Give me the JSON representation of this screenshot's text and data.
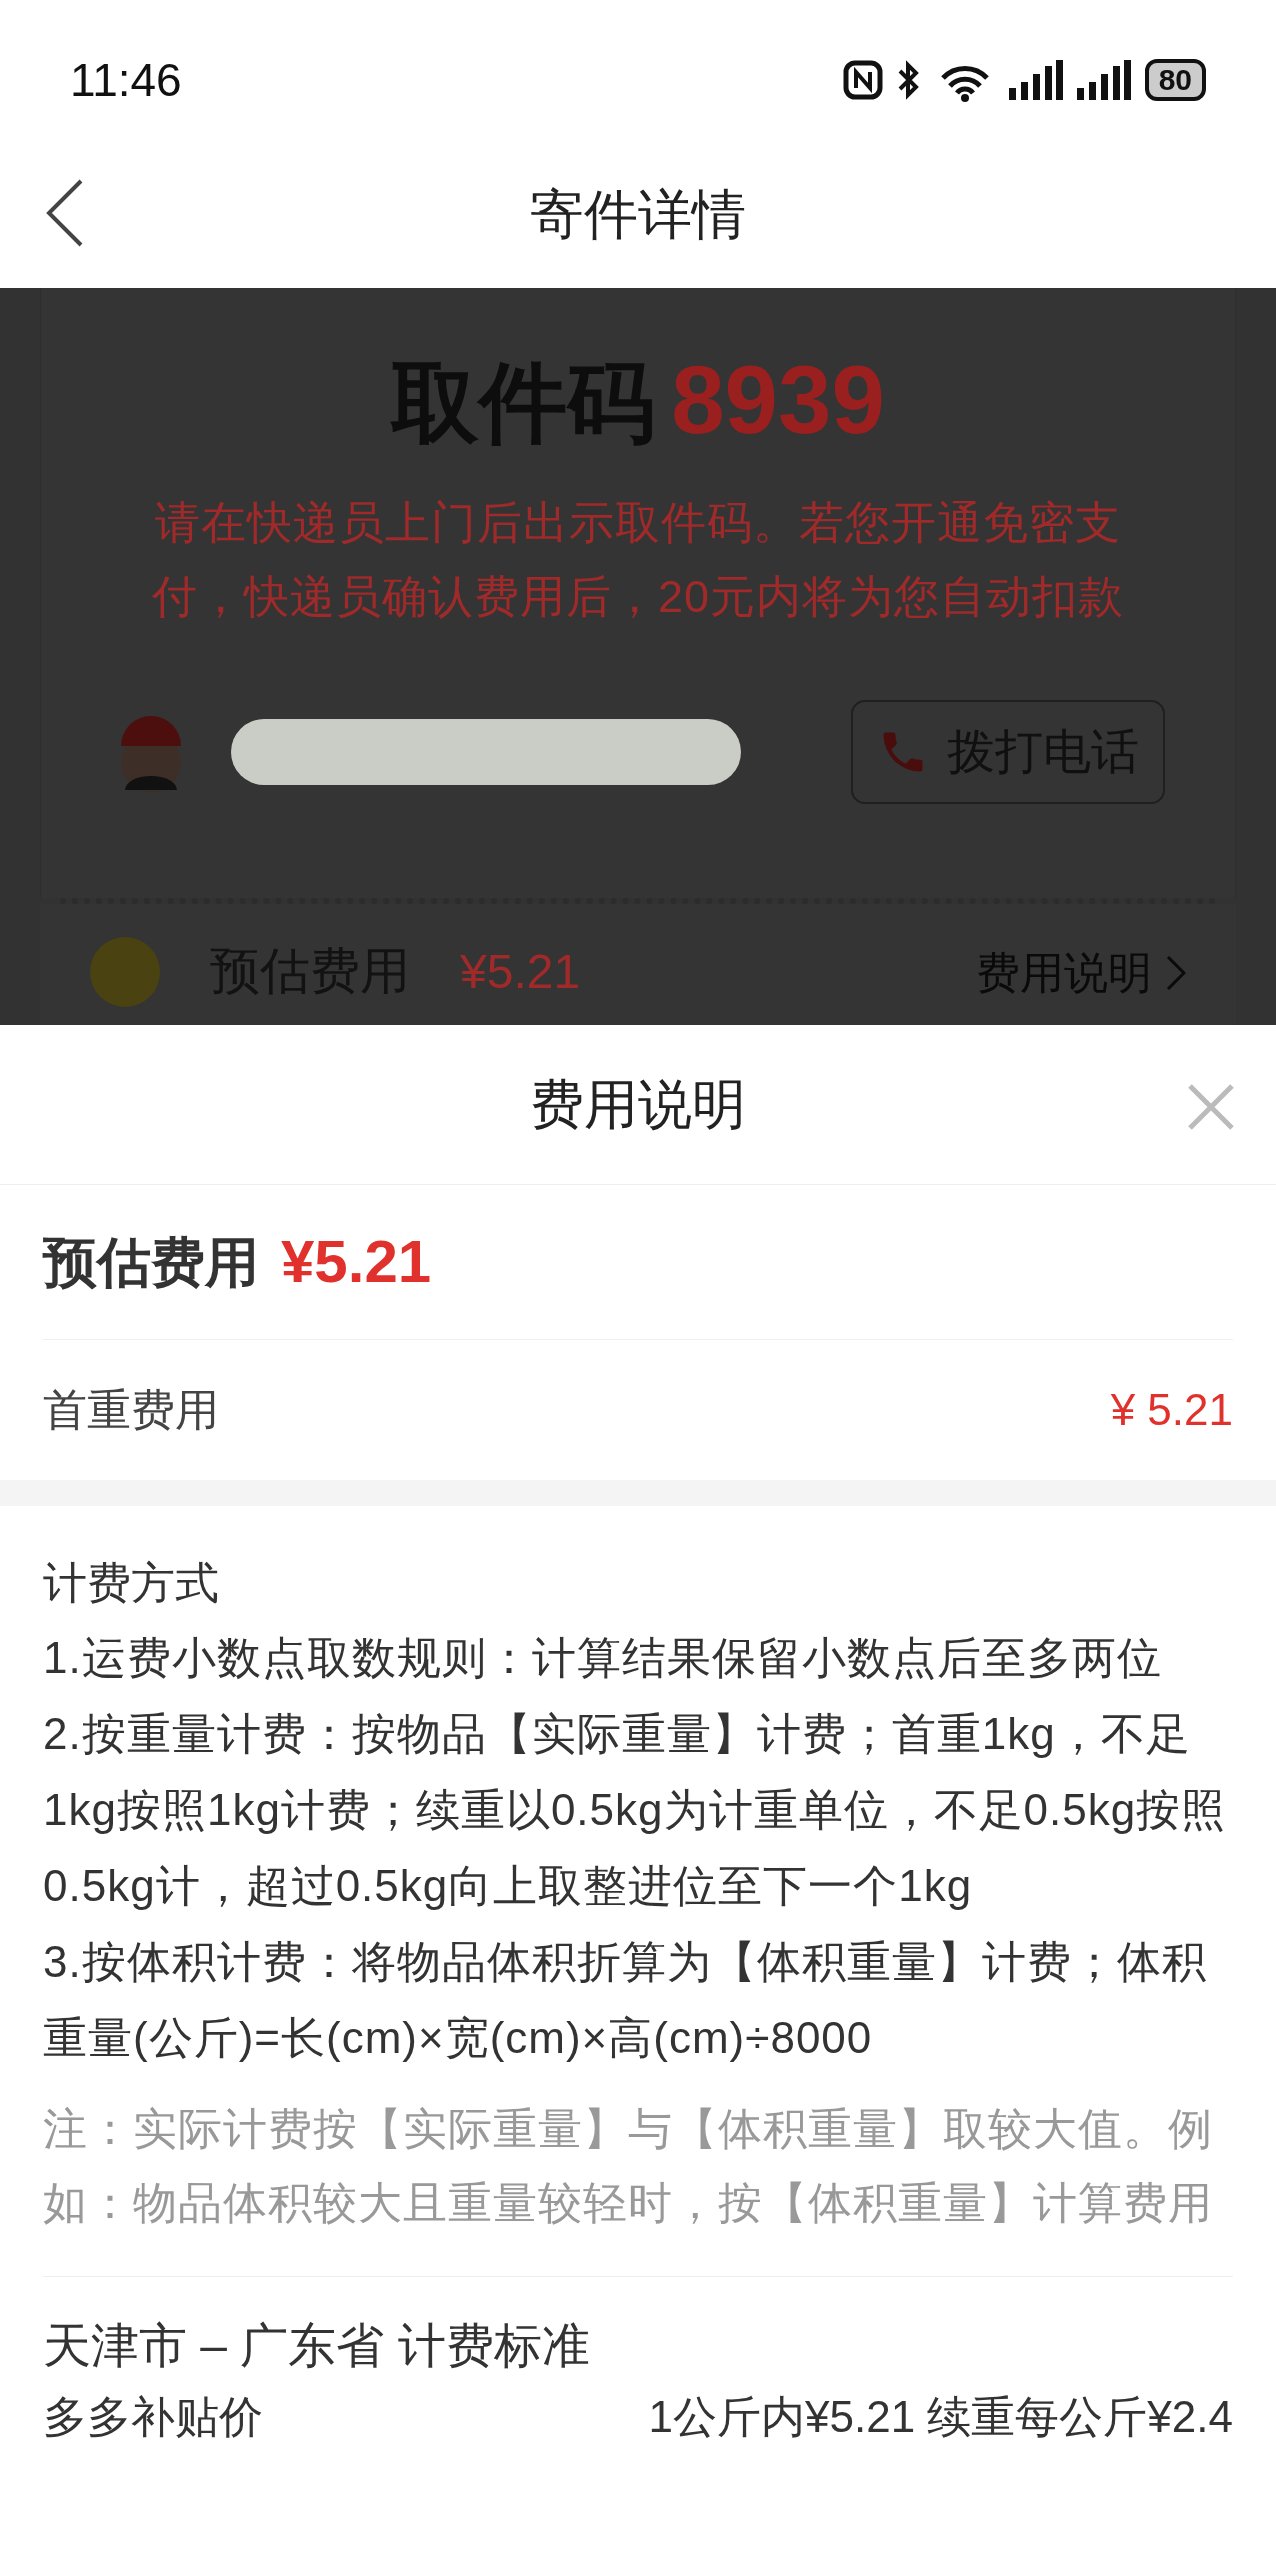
{
  "status_bar": {
    "time": "11:46",
    "battery": "80"
  },
  "nav": {
    "title": "寄件详情"
  },
  "pickup": {
    "label": "取件码",
    "code": "8939",
    "notice": "请在快递员上门后出示取件码。若您开通免密支付，快递员确认费用后，20元内将为您自动扣款",
    "call_button": "拨打电话"
  },
  "fee_row": {
    "label": "预估费用",
    "amount": "¥5.21",
    "link": "费用说明"
  },
  "sheet": {
    "title": "费用说明",
    "total_label": "预估费用",
    "total_amount": "¥5.21",
    "items": [
      {
        "label": "首重费用",
        "amount": "¥ 5.21"
      }
    ],
    "method_title": "计费方式",
    "rules": [
      "1.运费小数点取数规则：计算结果保留小数点后至多两位",
      "2.按重量计费：按物品【实际重量】计费；首重1kg，不足1kg按照1kg计费；续重以0.5kg为计重单位，不足0.5kg按照0.5kg计，超过0.5kg向上取整进位至下一个1kg",
      "3.按体积计费：将物品体积折算为【体积重量】计费；体积重量(公斤)=长(cm)×宽(cm)×高(cm)÷8000"
    ],
    "note": "注：实际计费按【实际重量】与【体积重量】取较大值。例如：物品体积较大且重量较轻时，按【体积重量】计算费用",
    "standard_title": "天津市 – 广东省 计费标准",
    "standard_rows": [
      {
        "label": "多多补贴价",
        "value": "1公斤内¥5.21 续重每公斤¥2.4"
      }
    ]
  }
}
